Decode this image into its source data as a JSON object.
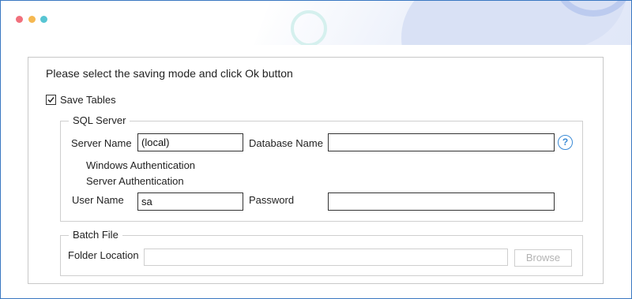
{
  "window": {
    "controls": [
      "close-dot",
      "minimize-dot",
      "maximize-dot"
    ],
    "colors": {
      "close": "#f1707c",
      "minimize": "#f5b851",
      "maximize": "#57c5d3",
      "border": "#3a78c2"
    }
  },
  "instruction": "Please select the saving mode and click Ok button",
  "save_tables": {
    "label": "Save Tables",
    "checked": true
  },
  "sql_server": {
    "title": "SQL Server",
    "server_name_label": "Server Name",
    "server_name_value": "(local)",
    "database_name_label": "Database Name",
    "database_name_value": "",
    "help_symbol": "?",
    "windows_auth_label": "Windows Authentication",
    "server_auth_label": "Server Authentication",
    "user_name_label": "User Name",
    "user_name_value": "sa",
    "password_label": "Password",
    "password_value": ""
  },
  "batch_file": {
    "title": "Batch File",
    "folder_location_label": "Folder Location",
    "folder_location_value": "",
    "browse_label": "Browse"
  }
}
